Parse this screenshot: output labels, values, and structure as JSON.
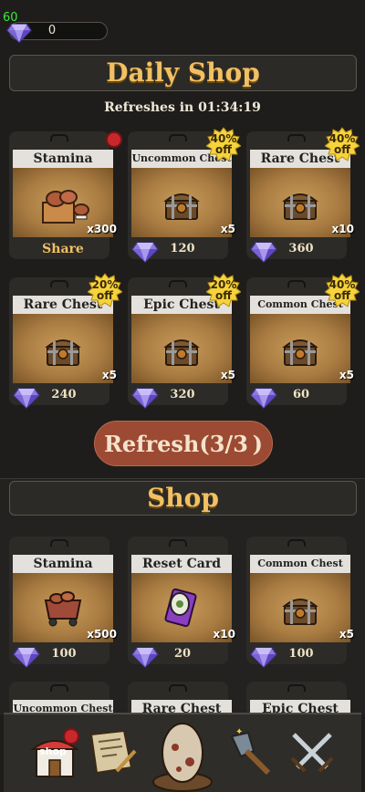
{
  "fps": "60",
  "currency": {
    "gems": "0",
    "icon": "gem-icon"
  },
  "daily_shop": {
    "title": "Daily Shop",
    "refresh_text": "Refreshes in 01:34:19",
    "refresh_button": "Refresh(3/3 )",
    "items": [
      {
        "title": "Stamina",
        "qty": "x300",
        "action": "Share",
        "has_alert": true
      },
      {
        "title": "Uncommon Chest",
        "qty": "x5",
        "price": "120",
        "badge": [
          "40%",
          "off"
        ]
      },
      {
        "title": "Rare Chest",
        "qty": "x10",
        "price": "360",
        "badge": [
          "40%",
          "off"
        ]
      },
      {
        "title": "Rare Chest",
        "qty": "x5",
        "price": "240",
        "badge": [
          "20%",
          "off"
        ]
      },
      {
        "title": "Epic Chest",
        "qty": "x5",
        "price": "320",
        "badge": [
          "20%",
          "off"
        ]
      },
      {
        "title": "Common Chest",
        "qty": "x5",
        "price": "60",
        "badge": [
          "40%",
          "off"
        ]
      }
    ]
  },
  "shop": {
    "title": "Shop",
    "items": [
      {
        "title": "Stamina",
        "qty": "x500",
        "price": "100"
      },
      {
        "title": "Reset Card",
        "qty": "x10",
        "price": "20"
      },
      {
        "title": "Common Chest",
        "qty": "x5",
        "price": "100"
      },
      {
        "title": "Uncommon Chest"
      },
      {
        "title": "Rare Chest"
      },
      {
        "title": "Epic Chest"
      }
    ]
  },
  "nav": [
    {
      "label": "shop",
      "icon": "shop-icon"
    },
    {
      "icon": "scroll-icon"
    },
    {
      "icon": "egg-icon"
    },
    {
      "icon": "shovel-icon"
    },
    {
      "icon": "crossed-swords-icon"
    }
  ],
  "colors": {
    "accent": "#f2c063",
    "button": "#9c4a33",
    "background": "#1e1d1b"
  }
}
